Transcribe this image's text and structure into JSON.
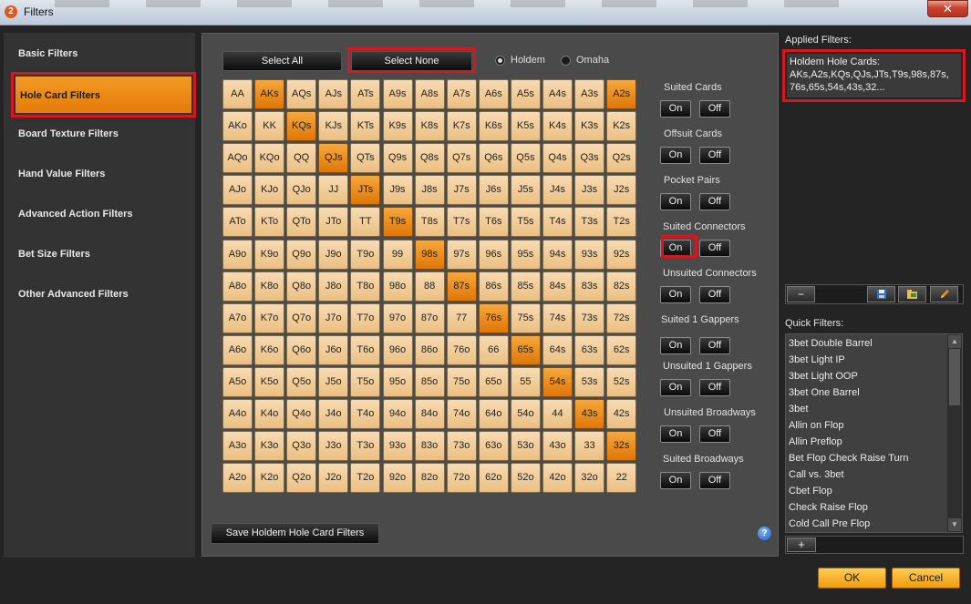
{
  "window": {
    "title": "Filters",
    "close_glyph": "✕",
    "app_icon_glyph": "2"
  },
  "sidebar": {
    "items": [
      {
        "label": "Basic Filters"
      },
      {
        "label": "Hole Card Filters",
        "active": true
      },
      {
        "label": "Board Texture Filters"
      },
      {
        "label": "Hand Value Filters"
      },
      {
        "label": "Advanced Action Filters"
      },
      {
        "label": "Bet Size Filters"
      },
      {
        "label": "Other Advanced Filters"
      }
    ]
  },
  "toolbar": {
    "select_all": "Select All",
    "select_none": "Select None"
  },
  "game_type": {
    "options": [
      "Holdem",
      "Omaha"
    ],
    "selected": "Holdem"
  },
  "hand_grid": {
    "rows": [
      [
        "AA",
        "AKs",
        "AQs",
        "AJs",
        "ATs",
        "A9s",
        "A8s",
        "A7s",
        "A6s",
        "A5s",
        "A4s",
        "A3s",
        "A2s"
      ],
      [
        "AKo",
        "KK",
        "KQs",
        "KJs",
        "KTs",
        "K9s",
        "K8s",
        "K7s",
        "K6s",
        "K5s",
        "K4s",
        "K3s",
        "K2s"
      ],
      [
        "AQo",
        "KQo",
        "QQ",
        "QJs",
        "QTs",
        "Q9s",
        "Q8s",
        "Q7s",
        "Q6s",
        "Q5s",
        "Q4s",
        "Q3s",
        "Q2s"
      ],
      [
        "AJo",
        "KJo",
        "QJo",
        "JJ",
        "JTs",
        "J9s",
        "J8s",
        "J7s",
        "J6s",
        "J5s",
        "J4s",
        "J3s",
        "J2s"
      ],
      [
        "ATo",
        "KTo",
        "QTo",
        "JTo",
        "TT",
        "T9s",
        "T8s",
        "T7s",
        "T6s",
        "T5s",
        "T4s",
        "T3s",
        "T2s"
      ],
      [
        "A9o",
        "K9o",
        "Q9o",
        "J9o",
        "T9o",
        "99",
        "98s",
        "97s",
        "96s",
        "95s",
        "94s",
        "93s",
        "92s"
      ],
      [
        "A8o",
        "K8o",
        "Q8o",
        "J8o",
        "T8o",
        "98o",
        "88",
        "87s",
        "86s",
        "85s",
        "84s",
        "83s",
        "82s"
      ],
      [
        "A7o",
        "K7o",
        "Q7o",
        "J7o",
        "T7o",
        "97o",
        "87o",
        "77",
        "76s",
        "75s",
        "74s",
        "73s",
        "72s"
      ],
      [
        "A6o",
        "K6o",
        "Q6o",
        "J6o",
        "T6o",
        "96o",
        "86o",
        "76o",
        "66",
        "65s",
        "64s",
        "63s",
        "62s"
      ],
      [
        "A5o",
        "K5o",
        "Q5o",
        "J5o",
        "T5o",
        "95o",
        "85o",
        "75o",
        "65o",
        "55",
        "54s",
        "53s",
        "52s"
      ],
      [
        "A4o",
        "K4o",
        "Q4o",
        "J4o",
        "T4o",
        "94o",
        "84o",
        "74o",
        "64o",
        "54o",
        "44",
        "43s",
        "42s"
      ],
      [
        "A3o",
        "K3o",
        "Q3o",
        "J3o",
        "T3o",
        "93o",
        "83o",
        "73o",
        "63o",
        "53o",
        "43o",
        "33",
        "32s"
      ],
      [
        "A2o",
        "K2o",
        "Q2o",
        "J2o",
        "T2o",
        "92o",
        "82o",
        "72o",
        "62o",
        "52o",
        "42o",
        "32o",
        "22"
      ]
    ],
    "selected": [
      "AKs",
      "A2s",
      "KQs",
      "QJs",
      "JTs",
      "T9s",
      "98s",
      "87s",
      "76s",
      "65s",
      "54s",
      "43s",
      "32s"
    ]
  },
  "toggle_groups": [
    {
      "label": "Suited Cards",
      "on": "On",
      "off": "Off"
    },
    {
      "label": "Offsuit Cards",
      "on": "On",
      "off": "Off"
    },
    {
      "label": "Pocket Pairs",
      "on": "On",
      "off": "Off"
    },
    {
      "label": "Suited Connectors",
      "on": "On",
      "off": "Off"
    },
    {
      "label": "Unsuited Connectors",
      "on": "On",
      "off": "Off"
    },
    {
      "label": "Suited 1 Gappers",
      "on": "On",
      "off": "Off"
    },
    {
      "label": "Unsuited 1 Gappers",
      "on": "On",
      "off": "Off"
    },
    {
      "label": "Unsuited Broadways",
      "on": "On",
      "off": "Off"
    },
    {
      "label": "Suited Broadways",
      "on": "On",
      "off": "Off"
    }
  ],
  "save_button": "Save Holdem Hole Card Filters",
  "help_glyph": "?",
  "applied_filters": {
    "heading": "Applied Filters:",
    "text": "Holdem Hole Cards: AKs,A2s,KQs,QJs,JTs,T9s,98s,87s, 76s,65s,54s,43s,32..."
  },
  "filter_tools": {
    "remove_glyph": "−"
  },
  "quick_filters": {
    "heading": "Quick Filters:",
    "items": [
      "3bet Double Barrel",
      "3bet Light IP",
      "3bet Light OOP",
      "3bet One Barrel",
      "3bet",
      "Allin on Flop",
      "Allin Preflop",
      "Bet Flop Check Raise Turn",
      "Call vs. 3bet",
      "Cbet Flop",
      "Check Raise Flop",
      "Cold Call Pre Flop"
    ],
    "add_glyph": "+",
    "scroll_up_glyph": "▲",
    "scroll_down_glyph": "▼"
  },
  "dialog": {
    "ok": "OK",
    "cancel": "Cancel"
  }
}
